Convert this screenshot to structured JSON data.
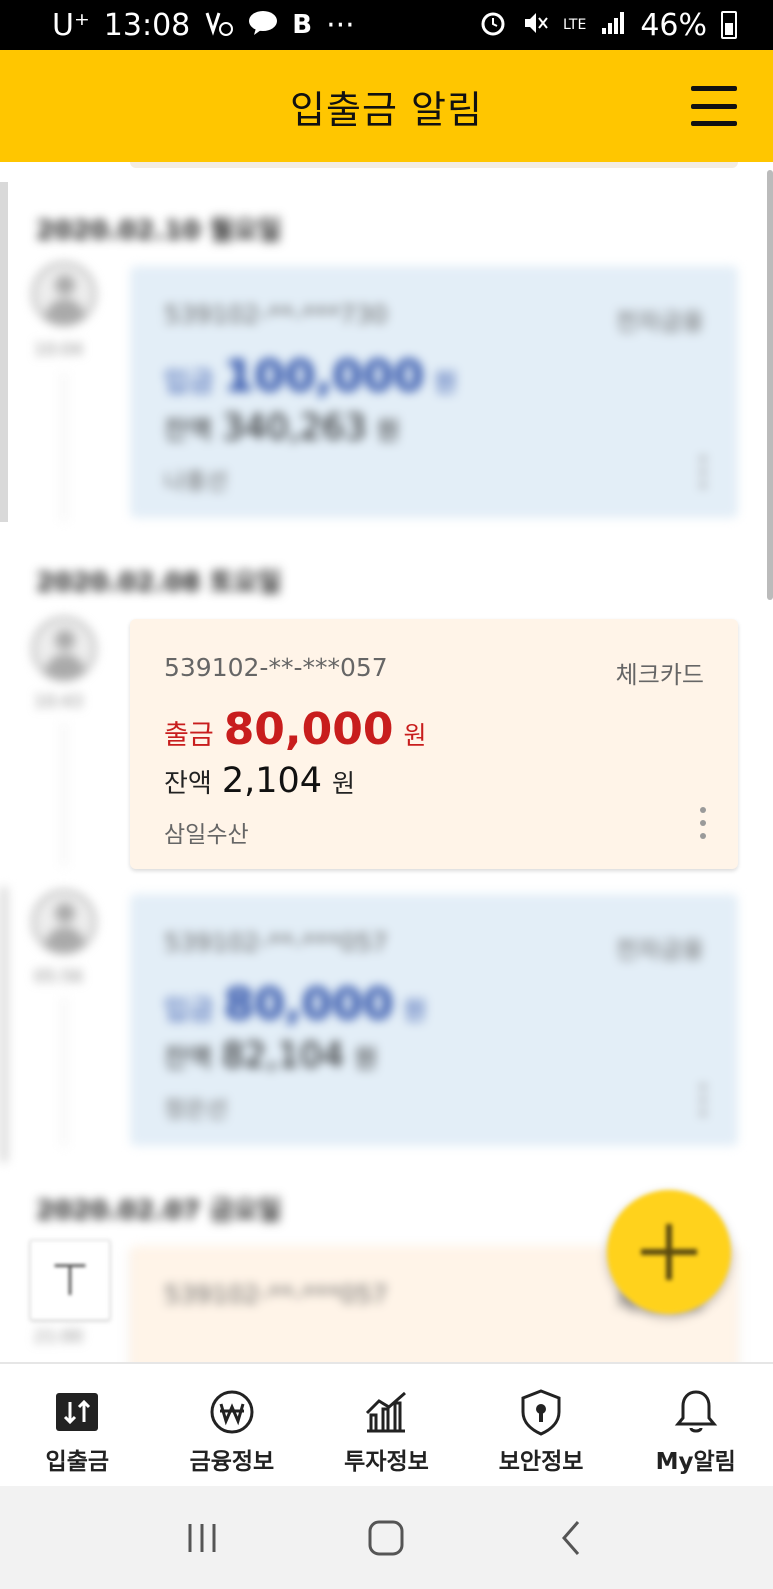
{
  "status_bar": {
    "carrier": "U⁺",
    "time": "13:08",
    "b_label": "B",
    "dots": "···",
    "lte": "LTE",
    "battery": "46%"
  },
  "header": {
    "title": "입출금 알림"
  },
  "feed": {
    "blurred_date_1": "2020.02.10 월요일",
    "blurred_card_1": {
      "account": "539102-**-***730",
      "type": "전자금융",
      "amount_label": "입금",
      "amount": "100,000",
      "unit": "원",
      "balance_label": "잔액",
      "balance": "340,263",
      "merchant": "나홍선",
      "time": "10:04"
    },
    "blurred_date_2": "2020.02.08 토요일",
    "focus_card": {
      "account": "539102-**-***057",
      "type": "체크카드",
      "amount_label": "출금",
      "amount": "80,000",
      "unit": "원",
      "balance_label": "잔액",
      "balance": "2,104",
      "balance_unit": "원",
      "merchant": "삼일수산",
      "time": "10:43"
    },
    "blurred_card_3": {
      "account": "539102-**-***057",
      "type": "전자금융",
      "amount_label": "입금",
      "amount": "80,000",
      "unit": "원",
      "balance_label": "잔액",
      "balance": "82,104",
      "merchant": "정은선",
      "time": "05:56"
    },
    "blurred_date_3": "2020.02.07 금요일",
    "blurred_card_4": {
      "account": "539102-**-***057",
      "type": "체크카드",
      "time": "21:00"
    }
  },
  "bottom_nav": {
    "items": [
      {
        "label": "입출금",
        "icon": "deposit-withdraw-icon"
      },
      {
        "label": "금융정보",
        "icon": "won-coin-icon"
      },
      {
        "label": "투자정보",
        "icon": "chart-icon"
      },
      {
        "label": "보안정보",
        "icon": "shield-lock-icon"
      },
      {
        "label": "My알림",
        "icon": "bell-icon"
      }
    ]
  },
  "colors": {
    "header_bg": "#ffc600",
    "withdraw_red": "#c81d1d",
    "deposit_blue": "#2a4ea8",
    "fab_yellow": "#ffd21c"
  }
}
